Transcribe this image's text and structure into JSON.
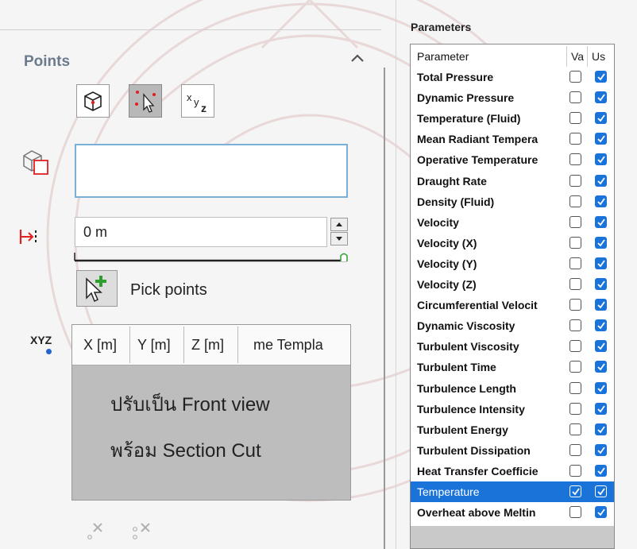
{
  "points_panel": {
    "title": "Points",
    "offset_value": "0 m",
    "pick_label": "Pick points",
    "xyz_icon_label": "XYZ",
    "columns": [
      "X [m]",
      "Y [m]",
      "Z [m]",
      "me Templa"
    ],
    "note_lines": [
      "ปรับเป็น Front view",
      "พร้อม Section Cut"
    ]
  },
  "parameters_panel": {
    "title": "Parameters",
    "header": {
      "name": "Parameter",
      "col_value": "Va",
      "col_use": "Us"
    },
    "rows": [
      {
        "name": "Total Pressure",
        "value_checked": false,
        "use_checked": true
      },
      {
        "name": "Dynamic Pressure",
        "value_checked": false,
        "use_checked": true
      },
      {
        "name": "Temperature (Fluid)",
        "value_checked": false,
        "use_checked": true
      },
      {
        "name": "Mean Radiant Tempera",
        "value_checked": false,
        "use_checked": true
      },
      {
        "name": "Operative Temperature",
        "value_checked": false,
        "use_checked": true
      },
      {
        "name": "Draught Rate",
        "value_checked": false,
        "use_checked": true
      },
      {
        "name": "Density (Fluid)",
        "value_checked": false,
        "use_checked": true
      },
      {
        "name": "Velocity",
        "value_checked": false,
        "use_checked": true
      },
      {
        "name": "Velocity (X)",
        "value_checked": false,
        "use_checked": true
      },
      {
        "name": "Velocity (Y)",
        "value_checked": false,
        "use_checked": true
      },
      {
        "name": "Velocity (Z)",
        "value_checked": false,
        "use_checked": true
      },
      {
        "name": "Circumferential Velocit",
        "value_checked": false,
        "use_checked": true
      },
      {
        "name": "Dynamic Viscosity",
        "value_checked": false,
        "use_checked": true
      },
      {
        "name": "Turbulent Viscosity",
        "value_checked": false,
        "use_checked": true
      },
      {
        "name": "Turbulent Time",
        "value_checked": false,
        "use_checked": true
      },
      {
        "name": "Turbulence Length",
        "value_checked": false,
        "use_checked": true
      },
      {
        "name": "Turbulence Intensity",
        "value_checked": false,
        "use_checked": true
      },
      {
        "name": "Turbulent Energy",
        "value_checked": false,
        "use_checked": true
      },
      {
        "name": "Turbulent Dissipation",
        "value_checked": false,
        "use_checked": true
      },
      {
        "name": "Heat Transfer Coefficie",
        "value_checked": false,
        "use_checked": true
      },
      {
        "name": "Temperature",
        "value_checked": true,
        "use_checked": true,
        "selected": true
      },
      {
        "name": "Overheat above Meltin",
        "value_checked": false,
        "use_checked": true
      }
    ]
  },
  "colors": {
    "accent": "#1a73d9",
    "focus_border": "#7ab0d8",
    "title_gray": "#6b7a8c",
    "pick_green": "#2e9e2e",
    "red_marker": "#e02020"
  }
}
